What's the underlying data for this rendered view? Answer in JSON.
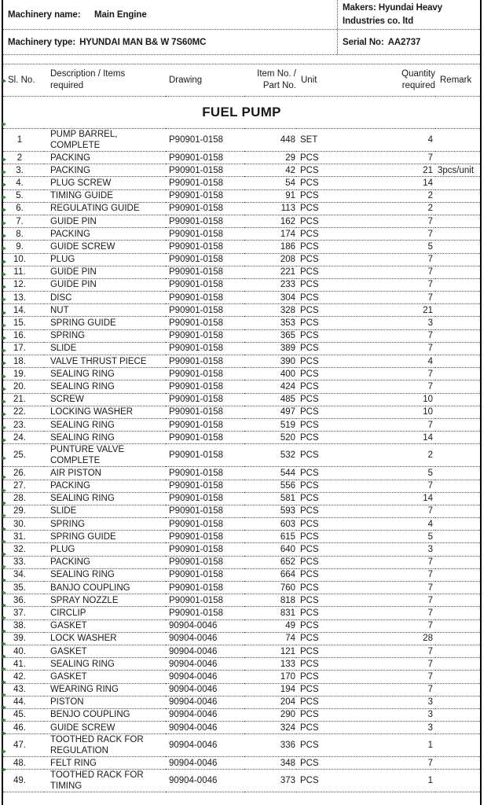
{
  "document": {
    "header": {
      "machinery_name_label": "Machinery name:",
      "machinery_name_value": "Main Engine",
      "makers_line1": "Makers: Hyundai Heavy",
      "makers_line2": "Industries co. ltd",
      "machinery_type_label": "Machinery type:",
      "machinery_type_value": "HYUNDAI MAN B& W 7S60MC",
      "serial_label": "Serial No:",
      "serial_value": "AA2737"
    },
    "table": {
      "columns": {
        "sl_no": "Sl. No.",
        "description_line1": "Description / Items",
        "description_line2": "required",
        "drawing": "Drawing",
        "item_no_line1": "Item No. /",
        "item_no_line2": "Part No.",
        "unit": "Unit",
        "quantity_line1": "Quantity",
        "quantity_line2": "required",
        "remark": "Remark"
      },
      "section_title": "FUEL PUMP",
      "rows": [
        {
          "sl": "1",
          "desc": "PUMP BARREL, COMPLETE",
          "drawing": "P90901-0158",
          "item": "448",
          "unit": "SET",
          "qty": "4",
          "remark": "",
          "tall": true
        },
        {
          "sl": "2",
          "desc": "PACKING",
          "drawing": "P90901-0158",
          "item": "29",
          "unit": "PCS",
          "qty": "7",
          "remark": "",
          "tall": false
        },
        {
          "sl": "3.",
          "desc": "PACKING",
          "drawing": "P90901-0158",
          "item": "42",
          "unit": "PCS",
          "qty": "21",
          "remark": "3pcs/unit",
          "tall": false
        },
        {
          "sl": "4.",
          "desc": "PLUG SCREW",
          "drawing": "P90901-0158",
          "item": "54",
          "unit": "PCS",
          "qty": "14",
          "remark": "",
          "tall": false
        },
        {
          "sl": "5.",
          "desc": "TIMING GUIDE",
          "drawing": "P90901-0158",
          "item": "91",
          "unit": "PCS",
          "qty": "2",
          "remark": "",
          "tall": false
        },
        {
          "sl": "6.",
          "desc": "REGULATING GUIDE",
          "drawing": "P90901-0158",
          "item": "113",
          "unit": "PCS",
          "qty": "2",
          "remark": "",
          "tall": false
        },
        {
          "sl": "7.",
          "desc": "GUIDE PIN",
          "drawing": "P90901-0158",
          "item": "162",
          "unit": "PCS",
          "qty": "7",
          "remark": "",
          "tall": false
        },
        {
          "sl": "8.",
          "desc": "PACKING",
          "drawing": "P90901-0158",
          "item": "174",
          "unit": "PCS",
          "qty": "7",
          "remark": "",
          "tall": false
        },
        {
          "sl": "9.",
          "desc": "GUIDE SCREW",
          "drawing": "P90901-0158",
          "item": "186",
          "unit": "PCS",
          "qty": "5",
          "remark": "",
          "tall": false
        },
        {
          "sl": "10.",
          "desc": "PLUG",
          "drawing": "P90901-0158",
          "item": "208",
          "unit": "PCS",
          "qty": "7",
          "remark": "",
          "tall": false
        },
        {
          "sl": "11.",
          "desc": "GUIDE PIN",
          "drawing": "P90901-0158",
          "item": "221",
          "unit": "PCS",
          "qty": "7",
          "remark": "",
          "tall": false
        },
        {
          "sl": "12.",
          "desc": "GUIDE PIN",
          "drawing": "P90901-0158",
          "item": "233",
          "unit": "PCS",
          "qty": "7",
          "remark": "",
          "tall": false
        },
        {
          "sl": "13.",
          "desc": "DISC",
          "drawing": "P90901-0158",
          "item": "304",
          "unit": "PCS",
          "qty": "7",
          "remark": "",
          "tall": false
        },
        {
          "sl": "14.",
          "desc": "NUT",
          "drawing": "P90901-0158",
          "item": "328",
          "unit": "PCS",
          "qty": "21",
          "remark": "",
          "tall": false
        },
        {
          "sl": "15.",
          "desc": "SPRING GUIDE",
          "drawing": "P90901-0158",
          "item": "353",
          "unit": "PCS",
          "qty": "3",
          "remark": "",
          "tall": false
        },
        {
          "sl": "16.",
          "desc": "SPRING",
          "drawing": "P90901-0158",
          "item": "365",
          "unit": "PCS",
          "qty": "7",
          "remark": "",
          "tall": false
        },
        {
          "sl": "17.",
          "desc": "SLIDE",
          "drawing": "P90901-0158",
          "item": "389",
          "unit": "PCS",
          "qty": "7",
          "remark": "",
          "tall": false
        },
        {
          "sl": "18.",
          "desc": "VALVE THRUST PIECE",
          "drawing": "P90901-0158",
          "item": "390",
          "unit": "PCS",
          "qty": "4",
          "remark": "",
          "tall": false
        },
        {
          "sl": "19.",
          "desc": "SEALING RING",
          "drawing": "P90901-0158",
          "item": "400",
          "unit": "PCS",
          "qty": "7",
          "remark": "",
          "tall": false
        },
        {
          "sl": "20.",
          "desc": "SEALING RING",
          "drawing": "P90901-0158",
          "item": "424",
          "unit": "PCS",
          "qty": "7",
          "remark": "",
          "tall": false
        },
        {
          "sl": "21.",
          "desc": "SCREW",
          "drawing": "P90901-0158",
          "item": "485",
          "unit": "PCS",
          "qty": "10",
          "remark": "",
          "tall": false
        },
        {
          "sl": "22.",
          "desc": "LOCKING WASHER",
          "drawing": "P90901-0158",
          "item": "497",
          "unit": "PCS",
          "qty": "10",
          "remark": "",
          "tall": false
        },
        {
          "sl": "23.",
          "desc": "SEALING RING",
          "drawing": "P90901-0158",
          "item": "519",
          "unit": "PCS",
          "qty": "7",
          "remark": "",
          "tall": false
        },
        {
          "sl": "24.",
          "desc": "SEALING RING",
          "drawing": "P90901-0158",
          "item": "520",
          "unit": "PCS",
          "qty": "14",
          "remark": "",
          "tall": false
        },
        {
          "sl": "25.",
          "desc": "PUNTURE VALVE COMPLETE",
          "drawing": "P90901-0158",
          "item": "532",
          "unit": "PCS",
          "qty": "2",
          "remark": "",
          "tall": true
        },
        {
          "sl": "26.",
          "desc": "AIR PISTON",
          "drawing": "P90901-0158",
          "item": "544",
          "unit": "PCS",
          "qty": "5",
          "remark": "",
          "tall": false
        },
        {
          "sl": "27.",
          "desc": "PACKING",
          "drawing": "P90901-0158",
          "item": "556",
          "unit": "PCS",
          "qty": "7",
          "remark": "",
          "tall": false
        },
        {
          "sl": "28.",
          "desc": "SEALING RING",
          "drawing": "P90901-0158",
          "item": "581",
          "unit": "PCS",
          "qty": "14",
          "remark": "",
          "tall": false
        },
        {
          "sl": "29.",
          "desc": "SLIDE",
          "drawing": "P90901-0158",
          "item": "593",
          "unit": "PCS",
          "qty": "7",
          "remark": "",
          "tall": false
        },
        {
          "sl": "30.",
          "desc": "SPRING",
          "drawing": "P90901-0158",
          "item": "603",
          "unit": "PCS",
          "qty": "4",
          "remark": "",
          "tall": false
        },
        {
          "sl": "31.",
          "desc": "SPRING GUIDE",
          "drawing": "P90901-0158",
          "item": "615",
          "unit": "PCS",
          "qty": "5",
          "remark": "",
          "tall": false
        },
        {
          "sl": "32.",
          "desc": "PLUG",
          "drawing": "P90901-0158",
          "item": "640",
          "unit": "PCS",
          "qty": "3",
          "remark": "",
          "tall": false
        },
        {
          "sl": "33.",
          "desc": "PACKING",
          "drawing": "P90901-0158",
          "item": "652",
          "unit": "PCS",
          "qty": "7",
          "remark": "",
          "tall": false
        },
        {
          "sl": "34.",
          "desc": "SEALING RING",
          "drawing": "P90901-0158",
          "item": "664",
          "unit": "PCS",
          "qty": "7",
          "remark": "",
          "tall": false
        },
        {
          "sl": "35.",
          "desc": "BANJO COUPLING",
          "drawing": "P90901-0158",
          "item": "760",
          "unit": "PCS",
          "qty": "7",
          "remark": "",
          "tall": false
        },
        {
          "sl": "36.",
          "desc": "SPRAY NOZZLE",
          "drawing": "P90901-0158",
          "item": "818",
          "unit": "PCS",
          "qty": "7",
          "remark": "",
          "tall": false
        },
        {
          "sl": "37.",
          "desc": "CIRCLIP",
          "drawing": "P90901-0158",
          "item": "831",
          "unit": "PCS",
          "qty": "7",
          "remark": "",
          "tall": false
        },
        {
          "sl": "38.",
          "desc": "GASKET",
          "drawing": "90904-0046",
          "item": "49",
          "unit": "PCS",
          "qty": "7",
          "remark": "",
          "tall": false
        },
        {
          "sl": "39.",
          "desc": "LOCK WASHER",
          "drawing": "90904-0046",
          "item": "74",
          "unit": "PCS",
          "qty": "28",
          "remark": "",
          "tall": false
        },
        {
          "sl": "40.",
          "desc": "GASKET",
          "drawing": "90904-0046",
          "item": "121",
          "unit": "PCS",
          "qty": "7",
          "remark": "",
          "tall": false
        },
        {
          "sl": "41.",
          "desc": "SEALING RING",
          "drawing": "90904-0046",
          "item": "133",
          "unit": "PCS",
          "qty": "7",
          "remark": "",
          "tall": false
        },
        {
          "sl": "42.",
          "desc": "GASKET",
          "drawing": "90904-0046",
          "item": "170",
          "unit": "PCS",
          "qty": "7",
          "remark": "",
          "tall": false
        },
        {
          "sl": "43.",
          "desc": "WEARING RING",
          "drawing": "90904-0046",
          "item": "194",
          "unit": "PCS",
          "qty": "7",
          "remark": "",
          "tall": false
        },
        {
          "sl": "44.",
          "desc": "PISTON",
          "drawing": "90904-0046",
          "item": "204",
          "unit": "PCS",
          "qty": "3",
          "remark": "",
          "tall": false
        },
        {
          "sl": "45.",
          "desc": "BENJO COUPLING",
          "drawing": "90904-0046",
          "item": "290",
          "unit": "PCS",
          "qty": "3",
          "remark": "",
          "tall": false
        },
        {
          "sl": "46.",
          "desc": "GUIDE SCREW",
          "drawing": "90904-0046",
          "item": "324",
          "unit": "PCS",
          "qty": "3",
          "remark": "",
          "tall": false
        },
        {
          "sl": "47.",
          "desc": "TOOTHED RACK FOR REGULATION",
          "drawing": "90904-0046",
          "item": "336",
          "unit": "PCS",
          "qty": "1",
          "remark": "",
          "tall": true
        },
        {
          "sl": "48.",
          "desc": "FELT RING",
          "drawing": "90904-0046",
          "item": "348",
          "unit": "PCS",
          "qty": "7",
          "remark": "",
          "tall": false
        },
        {
          "sl": "49.",
          "desc": "TOOTHED RACK FOR TIMING",
          "drawing": "90904-0046",
          "item": "373",
          "unit": "PCS",
          "qty": "1",
          "remark": "",
          "tall": true
        }
      ]
    }
  },
  "colors": {
    "text": "#1a1a1a",
    "grid": "#555555",
    "frame": "#000000",
    "revision_mark": "#2f7a2f"
  }
}
